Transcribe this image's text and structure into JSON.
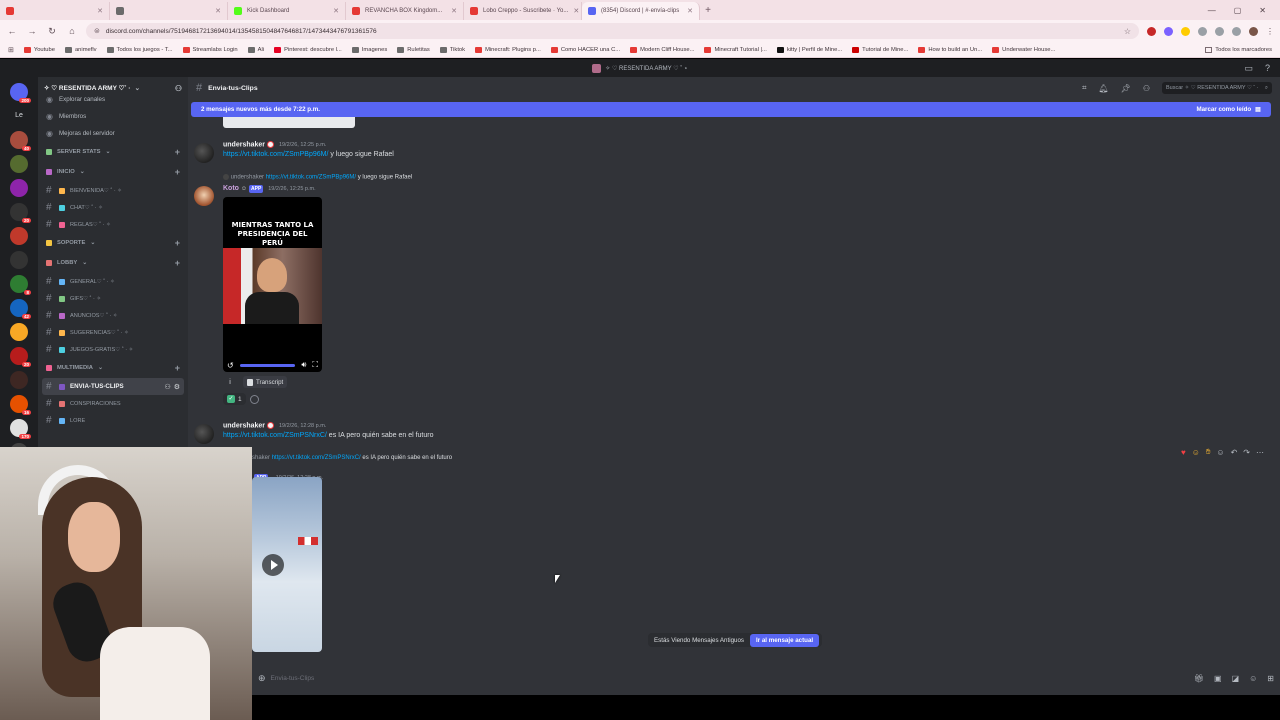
{
  "browser": {
    "tabs": [
      {
        "label": "",
        "color": "#e53935",
        "active": false
      },
      {
        "label": "",
        "color": "#6b6b6b",
        "active": false
      },
      {
        "label": "Kick Dashboard",
        "color": "#53fc18",
        "active": false
      },
      {
        "label": "REVANCHA BOX Kingdom...",
        "color": "#e53935",
        "active": false
      },
      {
        "label": "Lobo Creppo - Suscribete · Yo...",
        "color": "#e53935",
        "active": false
      },
      {
        "label": "(8354) Discord | #·envía-clips",
        "color": "#5865f2",
        "active": true
      }
    ],
    "url": "discord.com/channels/751946817213694014/1354581504847646817/1473443476791361576",
    "bookmarks": [
      "Youtube",
      "animeflv",
      "Todos los juegos - T...",
      "Streamlabs Login",
      "Ali",
      "Pinterest: descubre l...",
      "Imagenes",
      "Ruletitas",
      "Tiktok",
      "Minecraft: Plugins p...",
      "Como HACER una C...",
      "Modern Cliff House...",
      "Minecraft Tutorial |...",
      "kitty | Perfil de Mine...",
      "Tutorial de Mine...",
      "How to build an Un...",
      "Underwater House..."
    ],
    "bookmarks_all": "Todos los marcadores"
  },
  "app": {
    "title": "✧ ♡ RESENTIDA ARMY ♡ ˚ ⋆",
    "server_name": "✧ ♡ RESENTIDA ARMY ♡˚ ·",
    "guild_badges": [
      "200",
      "",
      "40",
      "",
      "",
      "20",
      "",
      "",
      "8",
      "42",
      "",
      "20",
      "",
      "16",
      "170",
      "",
      "",
      "8"
    ]
  },
  "sidebar": {
    "items": [
      {
        "type": "link",
        "label": "Explorar canales",
        "icon": "compass-icon"
      },
      {
        "type": "link",
        "label": "Miembros",
        "icon": "people-icon"
      },
      {
        "type": "link",
        "label": "Mejoras del servidor",
        "icon": "boost-icon"
      },
      {
        "type": "cat",
        "label": "SERVER STATS"
      },
      {
        "type": "cat",
        "label": "INICIO"
      },
      {
        "type": "ch",
        "label": "BIENVENIDA♡ ˚ · ✧"
      },
      {
        "type": "ch",
        "label": "CHAT♡ ˚ · ✧"
      },
      {
        "type": "ch",
        "label": "REGLAS♡ ˚ · ✧"
      },
      {
        "type": "cat",
        "label": "SOPORTE"
      },
      {
        "type": "cat",
        "label": "LOBBY"
      },
      {
        "type": "ch",
        "label": "GENERAL♡ ˚ · ✧"
      },
      {
        "type": "ch",
        "label": "GIFS♡ ˚ · ✧"
      },
      {
        "type": "ch",
        "label": "ANUNCIOS♡ ˚ · ✧"
      },
      {
        "type": "ch",
        "label": "SUGERENCIAS♡ ˚ · ✧"
      },
      {
        "type": "ch",
        "label": "JUEGOS-GRATIS♡ ˚ · ✧"
      },
      {
        "type": "cat",
        "label": "MULTIMEDIA"
      },
      {
        "type": "active",
        "label": "ENVIA-TUS-CLIPS"
      },
      {
        "type": "ch",
        "label": "CONSPIRACIONES"
      },
      {
        "type": "ch",
        "label": "LORE"
      }
    ]
  },
  "channel": {
    "name": "Envia-tus-Clips",
    "search_placeholder": "Buscar ✧ ♡ RESENTIDA ARMY ♡ ˚ ·",
    "new_messages": "2 mensajes nuevos más desde 7:22 p.m.",
    "mark_read": "Marcar como leído"
  },
  "messages": {
    "m1": {
      "user": "undershaker",
      "time": "19/2/26, 12:25 p.m.",
      "link": "https://vt.tiktok.com/ZSmPBp96M/",
      "text": " y luego sigue Rafael"
    },
    "m2": {
      "reply_user": "undershaker",
      "reply_link": "https://vt.tiktok.com/ZSmPBp96M/",
      "reply_text": " y luego sigue Rafael",
      "user": "Koto",
      "app": "APP",
      "time": "19/2/26, 12:25 p.m.",
      "video_title": "MIENTRAS TANTO LA PRESIDENCIA DEL PERÚ",
      "transcript": "Transcript",
      "reaction_count": "1"
    },
    "m3": {
      "user": "undershaker",
      "time": "19/2/26, 12:28 p.m.",
      "link": "https://vt.tiktok.com/ZSmPSNrxC/",
      "text": " es IA pero quién sabe en el futuro"
    },
    "m4": {
      "reply_user": "shaker",
      "reply_link": "https://vt.tiktok.com/ZSmPSNrxC/",
      "reply_text": " es IA pero quién sabe en el futuro",
      "app": "APP",
      "time": "19/2/26, 12:28 p.m."
    }
  },
  "footer": {
    "old_messages": "Estás Viendo Mensajes Antiguos",
    "jump": "Ir al mensaje actual",
    "composer_placeholder": "Envia-tus-Clips"
  },
  "colors": {
    "accent": "#5865f2",
    "link": "#00a8fc",
    "bg": "#313338"
  }
}
